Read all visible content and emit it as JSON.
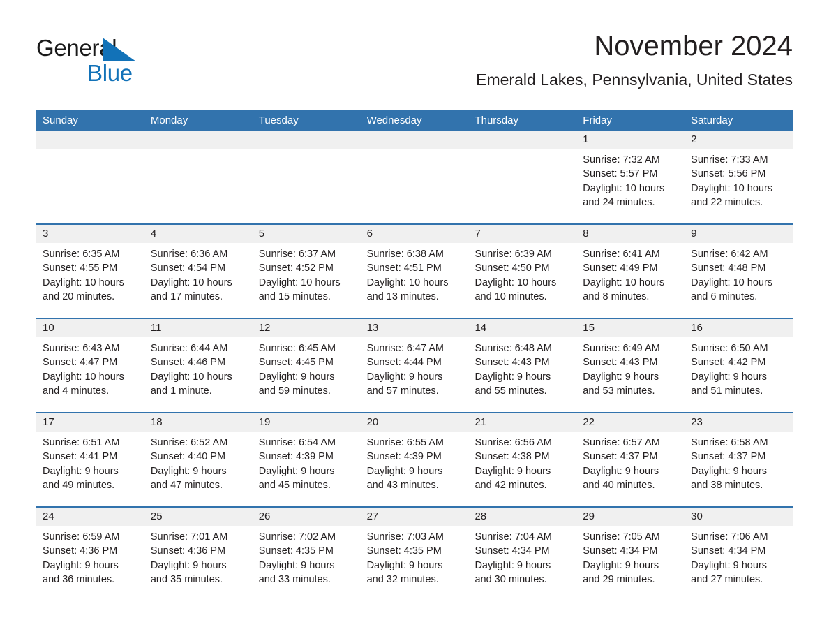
{
  "brand": {
    "line1": "General",
    "line2": "Blue",
    "triangle_color": "#1272b8"
  },
  "header": {
    "month_title": "November 2024",
    "location": "Emerald Lakes, Pennsylvania, United States"
  },
  "theme": {
    "header_blue": "#3273ad",
    "date_band_gray": "#f0f0f0",
    "text": "#231f20"
  },
  "weekdays": [
    "Sunday",
    "Monday",
    "Tuesday",
    "Wednesday",
    "Thursday",
    "Friday",
    "Saturday"
  ],
  "weeks": [
    [
      {
        "day": "",
        "sunrise": "",
        "sunset": "",
        "daylight1": "",
        "daylight2": "",
        "empty": true
      },
      {
        "day": "",
        "sunrise": "",
        "sunset": "",
        "daylight1": "",
        "daylight2": "",
        "empty": true
      },
      {
        "day": "",
        "sunrise": "",
        "sunset": "",
        "daylight1": "",
        "daylight2": "",
        "empty": true
      },
      {
        "day": "",
        "sunrise": "",
        "sunset": "",
        "daylight1": "",
        "daylight2": "",
        "empty": true
      },
      {
        "day": "",
        "sunrise": "",
        "sunset": "",
        "daylight1": "",
        "daylight2": "",
        "empty": true
      },
      {
        "day": "1",
        "sunrise": "Sunrise: 7:32 AM",
        "sunset": "Sunset: 5:57 PM",
        "daylight1": "Daylight: 10 hours",
        "daylight2": "and 24 minutes."
      },
      {
        "day": "2",
        "sunrise": "Sunrise: 7:33 AM",
        "sunset": "Sunset: 5:56 PM",
        "daylight1": "Daylight: 10 hours",
        "daylight2": "and 22 minutes."
      }
    ],
    [
      {
        "day": "3",
        "sunrise": "Sunrise: 6:35 AM",
        "sunset": "Sunset: 4:55 PM",
        "daylight1": "Daylight: 10 hours",
        "daylight2": "and 20 minutes."
      },
      {
        "day": "4",
        "sunrise": "Sunrise: 6:36 AM",
        "sunset": "Sunset: 4:54 PM",
        "daylight1": "Daylight: 10 hours",
        "daylight2": "and 17 minutes."
      },
      {
        "day": "5",
        "sunrise": "Sunrise: 6:37 AM",
        "sunset": "Sunset: 4:52 PM",
        "daylight1": "Daylight: 10 hours",
        "daylight2": "and 15 minutes."
      },
      {
        "day": "6",
        "sunrise": "Sunrise: 6:38 AM",
        "sunset": "Sunset: 4:51 PM",
        "daylight1": "Daylight: 10 hours",
        "daylight2": "and 13 minutes."
      },
      {
        "day": "7",
        "sunrise": "Sunrise: 6:39 AM",
        "sunset": "Sunset: 4:50 PM",
        "daylight1": "Daylight: 10 hours",
        "daylight2": "and 10 minutes."
      },
      {
        "day": "8",
        "sunrise": "Sunrise: 6:41 AM",
        "sunset": "Sunset: 4:49 PM",
        "daylight1": "Daylight: 10 hours",
        "daylight2": "and 8 minutes."
      },
      {
        "day": "9",
        "sunrise": "Sunrise: 6:42 AM",
        "sunset": "Sunset: 4:48 PM",
        "daylight1": "Daylight: 10 hours",
        "daylight2": "and 6 minutes."
      }
    ],
    [
      {
        "day": "10",
        "sunrise": "Sunrise: 6:43 AM",
        "sunset": "Sunset: 4:47 PM",
        "daylight1": "Daylight: 10 hours",
        "daylight2": "and 4 minutes."
      },
      {
        "day": "11",
        "sunrise": "Sunrise: 6:44 AM",
        "sunset": "Sunset: 4:46 PM",
        "daylight1": "Daylight: 10 hours",
        "daylight2": "and 1 minute."
      },
      {
        "day": "12",
        "sunrise": "Sunrise: 6:45 AM",
        "sunset": "Sunset: 4:45 PM",
        "daylight1": "Daylight: 9 hours",
        "daylight2": "and 59 minutes."
      },
      {
        "day": "13",
        "sunrise": "Sunrise: 6:47 AM",
        "sunset": "Sunset: 4:44 PM",
        "daylight1": "Daylight: 9 hours",
        "daylight2": "and 57 minutes."
      },
      {
        "day": "14",
        "sunrise": "Sunrise: 6:48 AM",
        "sunset": "Sunset: 4:43 PM",
        "daylight1": "Daylight: 9 hours",
        "daylight2": "and 55 minutes."
      },
      {
        "day": "15",
        "sunrise": "Sunrise: 6:49 AM",
        "sunset": "Sunset: 4:43 PM",
        "daylight1": "Daylight: 9 hours",
        "daylight2": "and 53 minutes."
      },
      {
        "day": "16",
        "sunrise": "Sunrise: 6:50 AM",
        "sunset": "Sunset: 4:42 PM",
        "daylight1": "Daylight: 9 hours",
        "daylight2": "and 51 minutes."
      }
    ],
    [
      {
        "day": "17",
        "sunrise": "Sunrise: 6:51 AM",
        "sunset": "Sunset: 4:41 PM",
        "daylight1": "Daylight: 9 hours",
        "daylight2": "and 49 minutes."
      },
      {
        "day": "18",
        "sunrise": "Sunrise: 6:52 AM",
        "sunset": "Sunset: 4:40 PM",
        "daylight1": "Daylight: 9 hours",
        "daylight2": "and 47 minutes."
      },
      {
        "day": "19",
        "sunrise": "Sunrise: 6:54 AM",
        "sunset": "Sunset: 4:39 PM",
        "daylight1": "Daylight: 9 hours",
        "daylight2": "and 45 minutes."
      },
      {
        "day": "20",
        "sunrise": "Sunrise: 6:55 AM",
        "sunset": "Sunset: 4:39 PM",
        "daylight1": "Daylight: 9 hours",
        "daylight2": "and 43 minutes."
      },
      {
        "day": "21",
        "sunrise": "Sunrise: 6:56 AM",
        "sunset": "Sunset: 4:38 PM",
        "daylight1": "Daylight: 9 hours",
        "daylight2": "and 42 minutes."
      },
      {
        "day": "22",
        "sunrise": "Sunrise: 6:57 AM",
        "sunset": "Sunset: 4:37 PM",
        "daylight1": "Daylight: 9 hours",
        "daylight2": "and 40 minutes."
      },
      {
        "day": "23",
        "sunrise": "Sunrise: 6:58 AM",
        "sunset": "Sunset: 4:37 PM",
        "daylight1": "Daylight: 9 hours",
        "daylight2": "and 38 minutes."
      }
    ],
    [
      {
        "day": "24",
        "sunrise": "Sunrise: 6:59 AM",
        "sunset": "Sunset: 4:36 PM",
        "daylight1": "Daylight: 9 hours",
        "daylight2": "and 36 minutes."
      },
      {
        "day": "25",
        "sunrise": "Sunrise: 7:01 AM",
        "sunset": "Sunset: 4:36 PM",
        "daylight1": "Daylight: 9 hours",
        "daylight2": "and 35 minutes."
      },
      {
        "day": "26",
        "sunrise": "Sunrise: 7:02 AM",
        "sunset": "Sunset: 4:35 PM",
        "daylight1": "Daylight: 9 hours",
        "daylight2": "and 33 minutes."
      },
      {
        "day": "27",
        "sunrise": "Sunrise: 7:03 AM",
        "sunset": "Sunset: 4:35 PM",
        "daylight1": "Daylight: 9 hours",
        "daylight2": "and 32 minutes."
      },
      {
        "day": "28",
        "sunrise": "Sunrise: 7:04 AM",
        "sunset": "Sunset: 4:34 PM",
        "daylight1": "Daylight: 9 hours",
        "daylight2": "and 30 minutes."
      },
      {
        "day": "29",
        "sunrise": "Sunrise: 7:05 AM",
        "sunset": "Sunset: 4:34 PM",
        "daylight1": "Daylight: 9 hours",
        "daylight2": "and 29 minutes."
      },
      {
        "day": "30",
        "sunrise": "Sunrise: 7:06 AM",
        "sunset": "Sunset: 4:34 PM",
        "daylight1": "Daylight: 9 hours",
        "daylight2": "and 27 minutes."
      }
    ]
  ]
}
